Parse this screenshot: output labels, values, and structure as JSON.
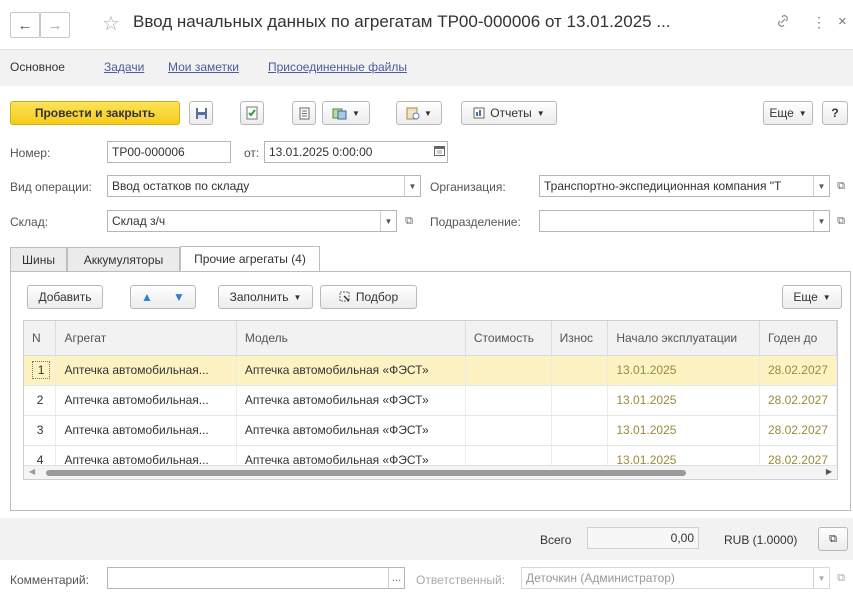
{
  "window": {
    "title": "Ввод начальных данных по агрегатам ТР00-000006 от 13.01.2025 ...",
    "back_icon": "←",
    "forward_icon": "→",
    "star_icon": "☆",
    "link_icon": "🔗",
    "more_icon": "⋮",
    "close_icon": "×"
  },
  "nav_tabs": [
    "Основное",
    "Задачи",
    "Мои заметки",
    "Присоединенные файлы"
  ],
  "toolbar": {
    "post_close_label": "Провести и закрыть",
    "reports_label": "Отчеты",
    "more_label": "Еще",
    "help_label": "?"
  },
  "form": {
    "number_label": "Номер:",
    "number_value": "ТР00-000006",
    "from_label": "от:",
    "date_value": "13.01.2025  0:00:00",
    "op_type_label": "Вид операции:",
    "op_type_value": "Ввод остатков по складу",
    "org_label": "Организация:",
    "org_value": "Транспортно-экспедиционная компания \"Т",
    "warehouse_label": "Склад:",
    "warehouse_value": "Склад з/ч",
    "dept_label": "Подразделение:",
    "dept_value": ""
  },
  "section_tabs": [
    "Шины",
    "Аккумуляторы",
    "Прочие агрегаты (4)"
  ],
  "table_toolbar": {
    "add_label": "Добавить",
    "fill_label": "Заполнить",
    "pick_label": "Подбор",
    "more_label": "Еще"
  },
  "table": {
    "columns": [
      "N",
      "Агрегат",
      "Модель",
      "Стоимость",
      "Износ",
      "Начало эксплуатации",
      "Годен до"
    ],
    "rows": [
      {
        "n": "1",
        "unit": "Аптечка автомобильная...",
        "model": "Аптечка автомобильная «ФЭСТ»",
        "cost": "",
        "wear": "",
        "start": "13.01.2025",
        "valid": "28.02.2027"
      },
      {
        "n": "2",
        "unit": "Аптечка автомобильная...",
        "model": "Аптечка автомобильная «ФЭСТ»",
        "cost": "",
        "wear": "",
        "start": "13.01.2025",
        "valid": "28.02.2027"
      },
      {
        "n": "3",
        "unit": "Аптечка автомобильная...",
        "model": "Аптечка автомобильная «ФЭСТ»",
        "cost": "",
        "wear": "",
        "start": "13.01.2025",
        "valid": "28.02.2027"
      },
      {
        "n": "4",
        "unit": "Аптечка автомобильная...",
        "model": "Аптечка автомобильная «ФЭСТ»",
        "cost": "",
        "wear": "",
        "start": "13.01.2025",
        "valid": "28.02.2027"
      }
    ]
  },
  "totals": {
    "total_label": "Всего",
    "total_value": "0,00",
    "currency": "RUB (1.0000)"
  },
  "bottom": {
    "comment_label": "Комментарий:",
    "comment_value": "",
    "responsible_label": "Ответственный:",
    "responsible_value": "Деточкин (Администратор)"
  },
  "colors": {
    "primary_button": "#f6cc1a",
    "link": "#4b5c9c",
    "selected_row": "#fdf2c2",
    "arrow_blue": "#3a7bd5"
  }
}
